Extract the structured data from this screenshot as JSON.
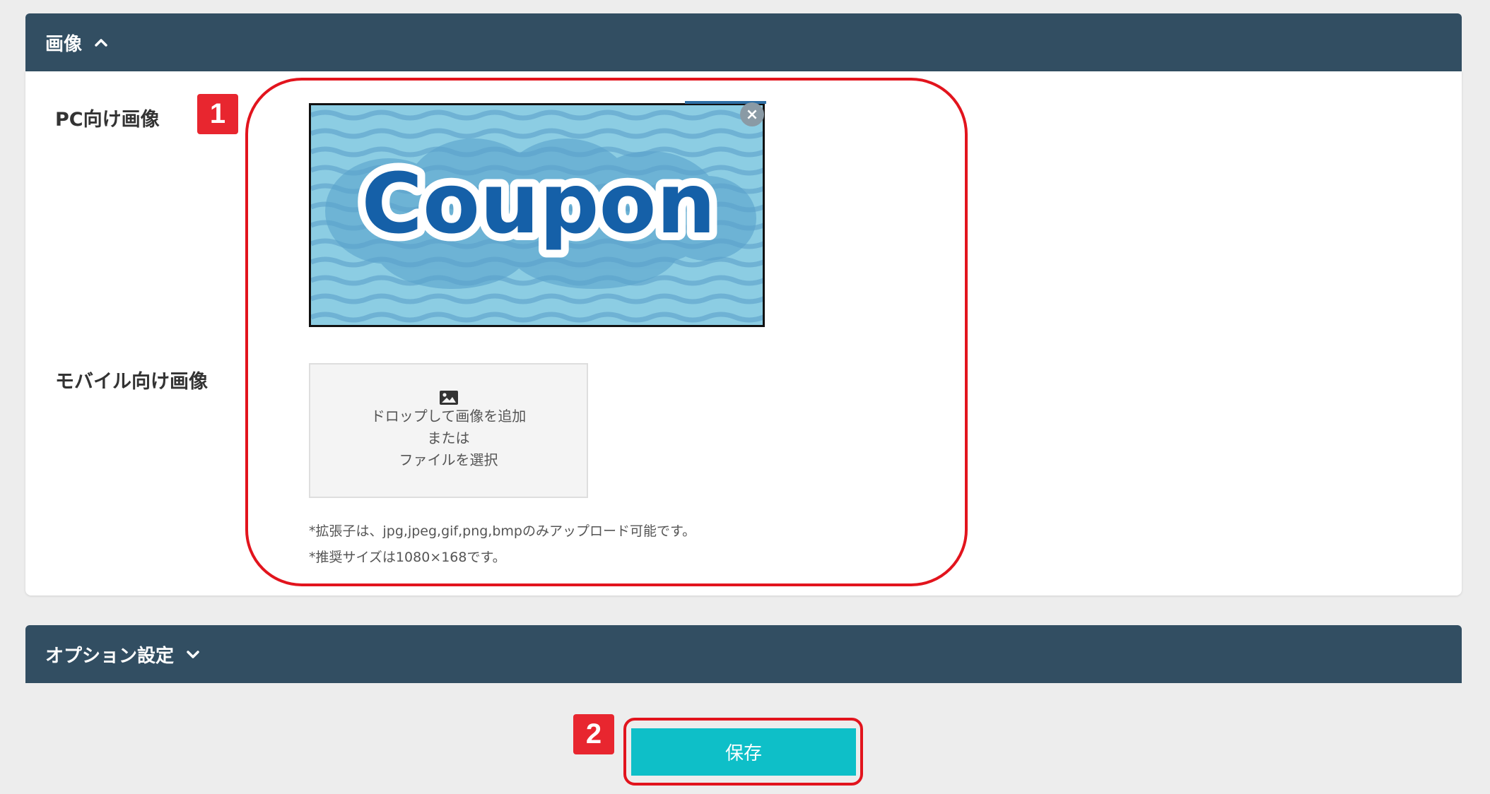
{
  "image_section": {
    "title": "画像",
    "pc_label": "PC向け画像",
    "mobile_label": "モバイル向け画像",
    "remove_symbol": "×",
    "dropzone": {
      "line1": "ドロップして画像を追加",
      "line2": "または",
      "line3": "ファイルを選択"
    },
    "note_extensions": "*拡張子は、jpg,jpeg,gif,png,bmpのみアップロード可能です。",
    "note_size": "*推奨サイズは1080×168です。",
    "coupon_image_text": "Coupon"
  },
  "option_section": {
    "title": "オプション設定"
  },
  "save_label": "保存",
  "badges": {
    "one": "1",
    "two": "2"
  },
  "colors": {
    "header": "#324e62",
    "save_button": "#0ebfc8",
    "highlight": "#e2141d",
    "badge": "#e8262f"
  }
}
